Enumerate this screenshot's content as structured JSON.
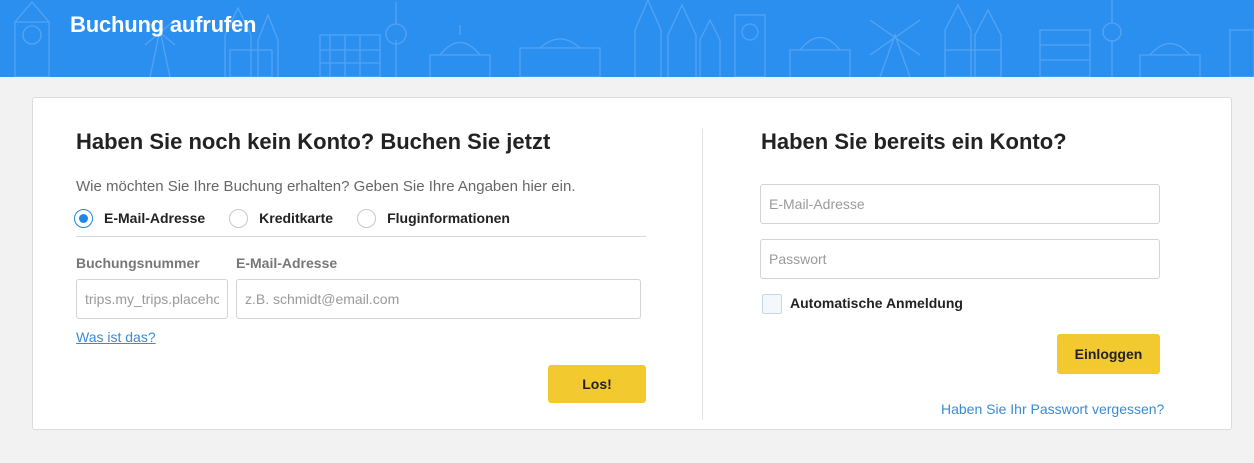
{
  "banner": {
    "title": "Buchung aufrufen"
  },
  "guest": {
    "heading": "Haben Sie noch kein Konto? Buchen Sie jetzt",
    "subtitle": "Wie möchten Sie Ihre Buchung erhalten? Geben Sie Ihre Angaben hier ein.",
    "options": [
      {
        "label": "E-Mail-Adresse",
        "selected": true
      },
      {
        "label": "Kreditkarte",
        "selected": false
      },
      {
        "label": "Fluginformationen",
        "selected": false
      }
    ],
    "booking_number": {
      "label": "Buchungsnummer",
      "placeholder": "trips.my_trips.placeholder",
      "value": ""
    },
    "email": {
      "label": "E-Mail-Adresse",
      "placeholder": "z.B. schmidt@email.com",
      "value": ""
    },
    "help_link": "Was ist das?",
    "submit_label": "Los!"
  },
  "member": {
    "heading": "Haben Sie bereits ein Konto?",
    "email_placeholder": "E-Mail-Adresse",
    "password_placeholder": "Passwort",
    "auto_login_label": "Automatische Anmeldung",
    "auto_login_checked": false,
    "login_label": "Einloggen",
    "forgot_link": "Haben Sie Ihr Passwort vergessen?"
  },
  "colors": {
    "banner": "#2b8ff0",
    "accent_button": "#f2c92f",
    "link": "#3a8ad6",
    "radio_selected": "#1e88e5"
  }
}
